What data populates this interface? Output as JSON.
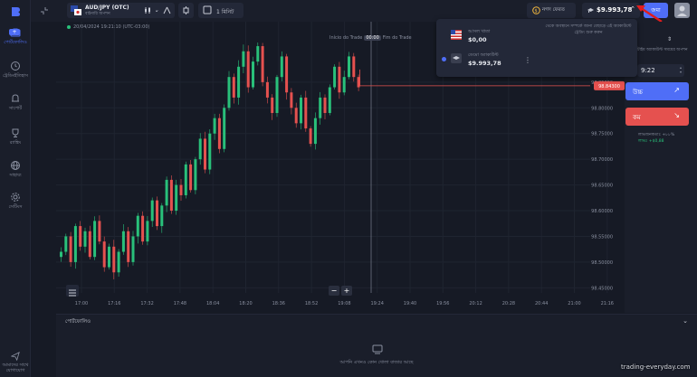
{
  "sidebar": {
    "items": [
      {
        "label": "পোর্টফোলিও",
        "icon": "briefcase-icon"
      },
      {
        "label": "ট্রেডিংইতিহাস",
        "icon": "clock-icon"
      },
      {
        "label": "সাপোর্ট",
        "icon": "bell-icon"
      },
      {
        "label": "র‍্যাঙ্কিং",
        "icon": "trophy-icon"
      },
      {
        "label": "সাহায্য",
        "icon": "globe-icon"
      },
      {
        "label": "সেটিংস",
        "icon": "gear-icon"
      }
    ],
    "support_label": "আমাদের সাথে যোগাযোগ"
  },
  "topbar": {
    "asset_name": "AUD/JPY (OTC)",
    "asset_sub": "বাইনারি অপশন",
    "timeframe": "1 মিনিট",
    "deposit_label": "নগদ ফেরত",
    "balance": "$9.993,78",
    "deposit_button": "জমা"
  },
  "chart": {
    "info": "20/04/2024 19:21:10 (UTC-03:00)",
    "trade_start": "Início do Trade",
    "trade_mid": "00:00",
    "trade_end": "Fim do Trade",
    "current_price": "98.84300",
    "price_ticks": [
      "98.85000",
      "98.80000",
      "98.75000",
      "98.70000",
      "98.65000",
      "98.60000",
      "98.55000",
      "98.50000",
      "98.45000"
    ],
    "time_ticks": [
      "17:00",
      "17:16",
      "17:32",
      "17:48",
      "18:04",
      "18:20",
      "18:36",
      "18:52",
      "19:08",
      "19:24",
      "19:40",
      "19:56",
      "20:12",
      "20:28",
      "20:44",
      "21:00",
      "21:16"
    ],
    "zoom_minus": "−",
    "zoom_plus": "+"
  },
  "chart_data": {
    "type": "candlestick",
    "series_color_up": "#29c07a",
    "series_color_down": "#e5514f",
    "close": [
      98.52,
      98.55,
      98.5,
      98.57,
      98.53,
      98.56,
      98.51,
      98.58,
      98.54,
      98.49,
      98.53,
      98.48,
      98.52,
      98.56,
      98.5,
      98.55,
      98.59,
      98.54,
      98.58,
      98.62,
      98.57,
      98.61,
      98.66,
      98.6,
      98.65,
      98.63,
      98.69,
      98.64,
      98.7,
      98.74,
      98.68,
      98.75,
      98.78,
      98.72,
      98.8,
      98.86,
      98.82,
      98.88,
      98.91,
      98.84,
      98.89,
      98.92,
      98.85,
      98.82,
      98.79,
      98.86,
      98.9,
      98.83,
      98.8,
      98.77,
      98.82,
      98.76,
      98.73,
      98.78,
      98.82,
      98.79,
      98.84,
      98.88,
      98.83,
      98.86,
      98.9,
      98.86,
      98.84
    ],
    "ylim": [
      98.44,
      98.95
    ]
  },
  "account_dropdown": {
    "real_name": "আসল খাতা",
    "real_balance": "$0,00",
    "demo_name": "ডেমো অ্যাকাউন্ট",
    "demo_balance": "$9.993,78",
    "note": "থেকে অবস্থানে সম্পর্কে জানা বেছাড়ে এই অ্যাকাউন্টে ট্রেডিং শুরু করুন"
  },
  "right_panel": {
    "amount_label": "টাইম অ্যাকাউন্ট সময়ের অপশন",
    "time_value": "9:22",
    "up_label": "উচ্চ",
    "down_label": "কম",
    "payout_label": "লাভজনকতাঃ +৮৮%",
    "payout_value": "লাভঃ +$0,88"
  },
  "portfolio": {
    "title": "পোর্টফোলিও",
    "empty_text": "আপনি এখনও কোন খোলা বাজার আছে"
  },
  "watermark": "trading-everyday.com"
}
